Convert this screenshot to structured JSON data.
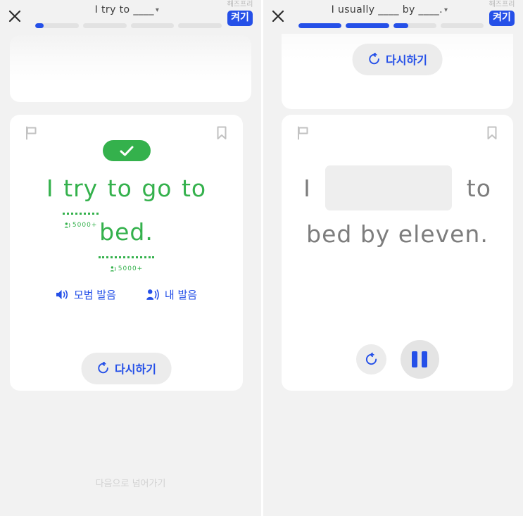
{
  "left": {
    "header": {
      "close_icon": "close-icon",
      "title": "I try to ____",
      "chevron": "▾",
      "handsfree_label": "해즈프리",
      "handsfree_button": "켜기",
      "progress": [
        20,
        0,
        0,
        0
      ]
    },
    "card": {
      "flag_icon": "flag-icon",
      "bookmark_icon": "bookmark-icon",
      "status_icon": "check-icon",
      "sentence_line1": [
        "I",
        "try",
        "to",
        "go",
        "to"
      ],
      "sentence_line2": [
        "bed."
      ],
      "marked_words": [
        "try",
        "bed."
      ],
      "badge_count": "5000+",
      "audio": [
        {
          "icon": "speaker-icon",
          "label": "모범 발음"
        },
        {
          "icon": "person-speaking-icon",
          "label": "내 발음"
        }
      ],
      "retry_icon": "rotate-left-icon",
      "retry_label": "다시하기"
    },
    "skip_label": "다음으로 넘어가기"
  },
  "right": {
    "header": {
      "close_icon": "close-icon",
      "title": "I usually ____ by ____.",
      "chevron": "▾",
      "handsfree_label": "해즈프리",
      "handsfree_button": "켜기",
      "progress": [
        100,
        100,
        35,
        0
      ]
    },
    "prev_card": {
      "retry_icon": "rotate-left-icon",
      "retry_label": "다시하기"
    },
    "card": {
      "flag_icon": "flag-icon",
      "bookmark_icon": "bookmark-icon",
      "sentence_pre": "I",
      "sentence_blank": "",
      "sentence_post": "to",
      "sentence_line2": "bed by eleven.",
      "replay_icon": "rotate-left-icon",
      "pause_icon": "pause-icon"
    }
  },
  "colors": {
    "accent_blue": "#2550e8",
    "success_green": "#34b14c",
    "background": "#f2f2f2",
    "card": "#ffffff",
    "muted_gray": "#7d7d7d"
  }
}
